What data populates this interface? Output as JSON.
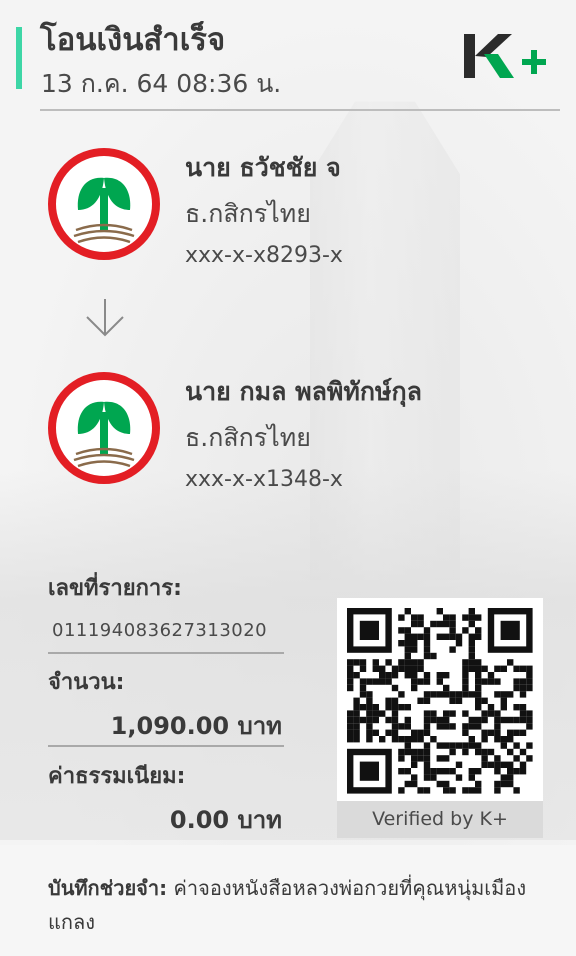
{
  "header": {
    "title": "โอนเงินสำเร็จ",
    "datetime": "13 ก.ค. 64  08:36 น.",
    "logo_text": "K+",
    "accent_color": "#3dd6a6"
  },
  "sender": {
    "name": "นาย ธวัชชัย จ",
    "bank": "ธ.กสิกรไทย",
    "account": "xxx-x-x8293-x"
  },
  "receiver": {
    "name": "นาย กมล พลพิทักษ์กุล",
    "bank": "ธ.กสิกรไทย",
    "account": "xxx-x-x1348-x"
  },
  "details": {
    "ref_label": "เลขที่รายการ:",
    "ref_value": "011194083627313020",
    "amount_label": "จำนวน:",
    "amount_value": "1,090.00 บาท",
    "fee_label": "ค่าธรรมเนียม:",
    "fee_value": "0.00 บาท"
  },
  "qr": {
    "verified_text": "Verified by K+"
  },
  "memo": {
    "label": "บันทึกช่วยจำ:",
    "text": " ค่าจองหนังสือหลวงพ่อกวยที่คุณหนุ่มเมืองแกลง"
  },
  "colors": {
    "kbank_green": "#00a650",
    "kbank_red": "#e31e24",
    "logo_dark": "#2b2b2b"
  }
}
